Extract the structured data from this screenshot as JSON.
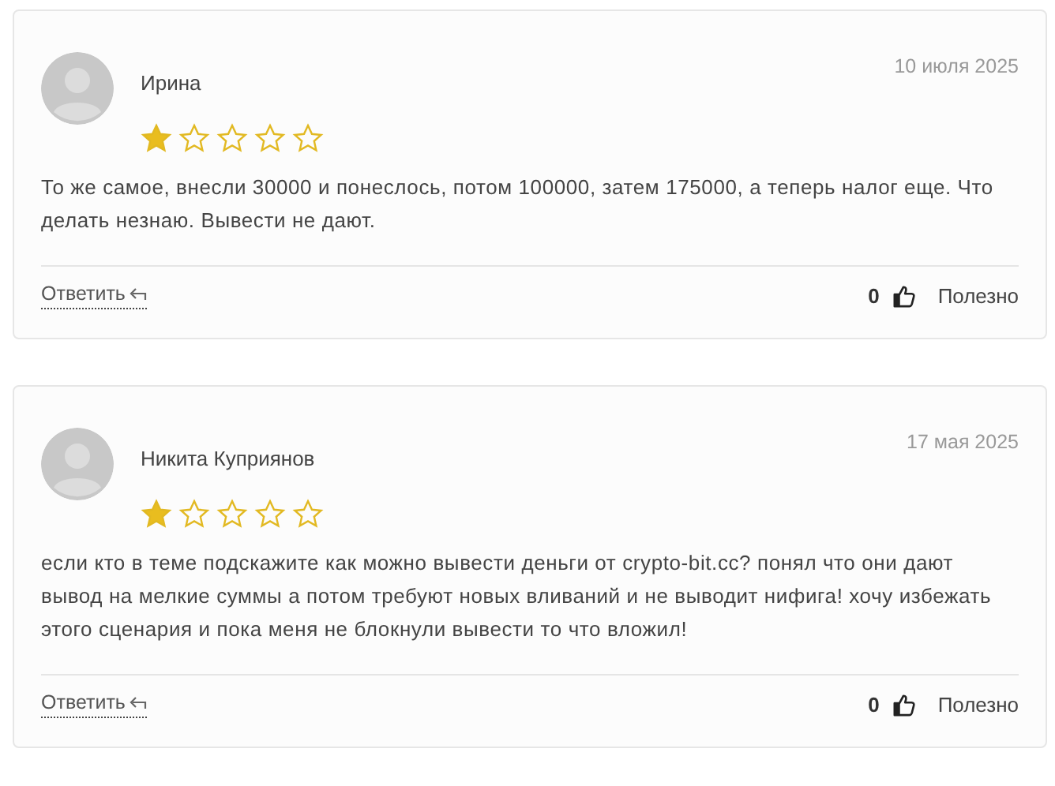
{
  "reviews": [
    {
      "author": "Ирина",
      "date": "10 июля 2025",
      "stars": 1,
      "text": "То же самое, внесли 30000 и понеслось, потом 100000, затем 175000, а теперь налог еще. Что делать незнаю. Вывести не дают.",
      "reply": "Ответить",
      "likes": "0",
      "helpful": "Полезно"
    },
    {
      "author": "Никита Куприянов",
      "date": "17 мая 2025",
      "stars": 1,
      "text": "если кто в теме подскажите как можно вывести деньги от crypto-bit.cc? понял что они дают вывод на мелкие суммы а потом требуют новых вливаний и не выводит нифига! хочу избежать этого сценария и пока меня не блокнули вывести то что вложил!",
      "reply": "Ответить",
      "likes": "0",
      "helpful": "Полезно"
    }
  ]
}
